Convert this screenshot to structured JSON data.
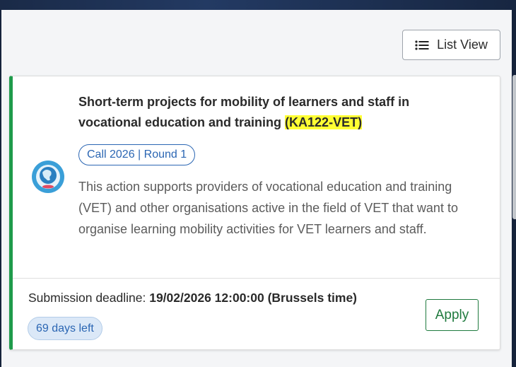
{
  "toolbar": {
    "list_view_label": "List View",
    "list_view_icon": "list-icon"
  },
  "card": {
    "accent_color": "#1f9b4b",
    "program_icon": "globe-icon",
    "title_main": "Short-term projects for mobility of learners and staff in vocational education and training ",
    "title_code": "(KA122-VET)",
    "call_badge": "Call 2026 | Round 1",
    "description": "This action supports providers of vocational education and training (VET) and other organisations active in the field of VET that want to organise learning mobility activities for VET learners and staff.",
    "deadline_label": "Submission deadline: ",
    "deadline_value": "19/02/2026 12:00:00 (Brussels time)",
    "days_left": "69 days left",
    "apply_label": "Apply"
  }
}
